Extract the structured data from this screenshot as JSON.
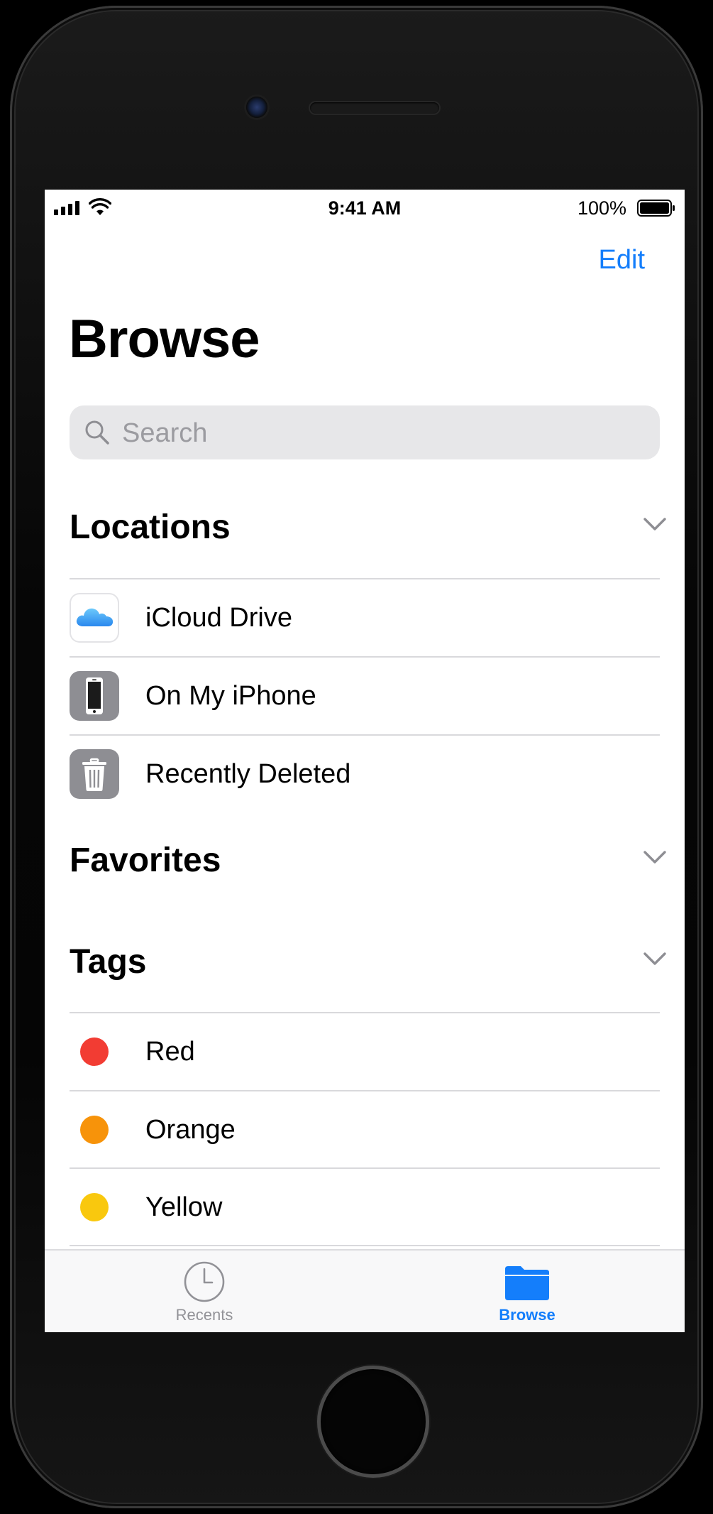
{
  "status_bar": {
    "time": "9:41 AM",
    "battery_percent": "100%",
    "battery_level": 1.0
  },
  "nav": {
    "edit_label": "Edit",
    "title": "Browse"
  },
  "search": {
    "placeholder": "Search",
    "value": ""
  },
  "sections": {
    "locations": {
      "title": "Locations",
      "items": [
        {
          "label": "iCloud Drive",
          "icon": "icloud-icon"
        },
        {
          "label": "On My iPhone",
          "icon": "iphone-icon"
        },
        {
          "label": "Recently Deleted",
          "icon": "trash-icon"
        }
      ]
    },
    "favorites": {
      "title": "Favorites"
    },
    "tags": {
      "title": "Tags",
      "items": [
        {
          "label": "Red",
          "color": "#f23c33"
        },
        {
          "label": "Orange",
          "color": "#f7930a"
        },
        {
          "label": "Yellow",
          "color": "#f9c80e"
        }
      ]
    }
  },
  "tab_bar": {
    "tabs": [
      {
        "label": "Recents",
        "icon": "clock-icon",
        "selected": false
      },
      {
        "label": "Browse",
        "icon": "folder-icon",
        "selected": true
      }
    ]
  },
  "colors": {
    "accent": "#147efb",
    "inactive": "#929297"
  }
}
